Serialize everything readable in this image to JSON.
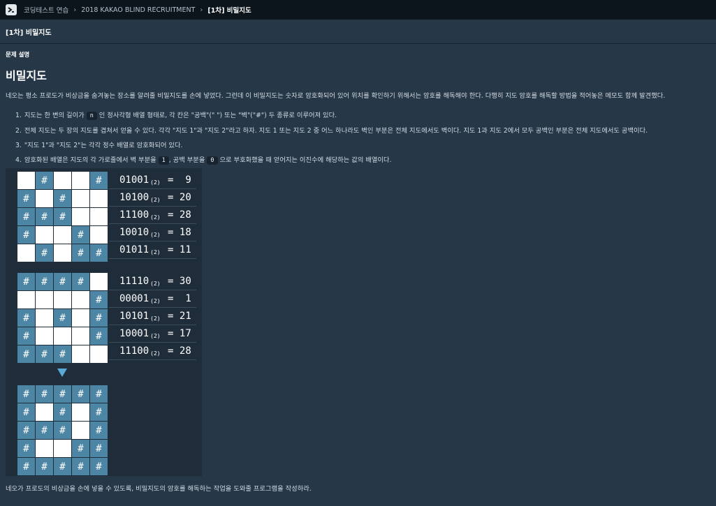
{
  "breadcrumb": {
    "items": [
      "코딩테스트 연습",
      "2018 KAKAO BLIND RECRUITMENT"
    ],
    "current": "[1차] 비밀지도"
  },
  "title": "[1차] 비밀지도",
  "section_label": "문제 설명",
  "heading": "비밀지도",
  "intro": "네오는 평소 프로도가 비상금을 숨겨놓는 장소를 알려줄 비밀지도를 손에 넣었다. 그런데 이 비밀지도는 숫자로 암호화되어 있어 위치를 확인하기 위해서는 암호를 해독해야 한다. 다행히 지도 암호를 해독할 방법을 적어놓은 메모도 함께 발견했다.",
  "rules": [
    {
      "num": "1.",
      "a": "지도는 한 변의 길이가",
      "code": "n",
      "b": "인 정사각형 배열 형태로, 각 칸은 \"공백\"(\" \") 또는 \"벽\"(\"#\") 두 종류로 이루어져 있다."
    },
    {
      "num": "2.",
      "text": "전체 지도는 두 장의 지도를 겹쳐서 얻을 수 있다. 각각 \"지도 1\"과 \"지도 2\"라고 하자. 지도 1 또는 지도 2 중 어느 하나라도 벽인 부분은 전체 지도에서도 벽이다. 지도 1과 지도 2에서 모두 공백인 부분은 전체 지도에서도 공백이다."
    },
    {
      "num": "3.",
      "text": "\"지도 1\"과 \"지도 2\"는 각각 정수 배열로 암호화되어 있다."
    },
    {
      "num": "4.",
      "a": "암호화된 배열은 지도의 각 가로줄에서 벽 부분을",
      "code1": "1",
      "b": ", 공백 부분을",
      "code2": "0",
      "c": "으로 부호화했을 때 얻어지는 이진수에 해당하는 값의 배열이다."
    }
  ],
  "wall_char": "#",
  "map1": {
    "rows": [
      "01001",
      "10100",
      "11100",
      "10010",
      "01011"
    ],
    "values": [
      "9",
      "20",
      "28",
      "18",
      "11"
    ]
  },
  "map2": {
    "rows": [
      "11110",
      "00001",
      "10101",
      "10001",
      "11100"
    ],
    "values": [
      "30",
      "1",
      "21",
      "17",
      "28"
    ]
  },
  "result": {
    "rows": [
      "11111",
      "10101",
      "11101",
      "10011",
      "11111"
    ]
  },
  "base_subscript": "(2)",
  "equals": "=",
  "colors": {
    "wall": "#4d86a5",
    "empty": "#ffffff",
    "arrow": "#5aa8d8",
    "topbar": "#0c151c",
    "background": "#263747"
  },
  "footer": "네오가 프로도의 비상금을 손에 넣을 수 있도록, 비밀지도의 암호를 해독하는 작업을 도와줄 프로그램을 작성하라."
}
